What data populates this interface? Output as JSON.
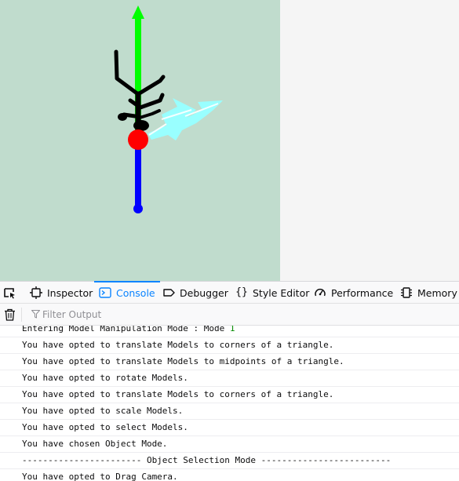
{
  "scene": {
    "background": "#c0dccd",
    "axis_colors": {
      "up": "#00ff00",
      "down": "#0000ff",
      "origin": "#ff0000",
      "model": "#000000",
      "arrow": "#99ffff"
    }
  },
  "devtools": {
    "tabs": [
      {
        "label": "Inspector",
        "icon": "inspector-icon"
      },
      {
        "label": "Console",
        "icon": "console-icon",
        "selected": true
      },
      {
        "label": "Debugger",
        "icon": "debugger-icon"
      },
      {
        "label": "Style Editor",
        "icon": "style-editor-icon"
      },
      {
        "label": "Performance",
        "icon": "performance-icon"
      },
      {
        "label": "Memory",
        "icon": "memory-icon"
      }
    ],
    "filter": {
      "placeholder": "Filter Output",
      "value": ""
    },
    "console_lines": [
      {
        "text": "Entering Model Manipulation Mode : Mode ",
        "num": "1"
      },
      {
        "text": "You have opted to translate Models to corners of a triangle."
      },
      {
        "text": "You have opted to translate Models to midpoints of a triangle."
      },
      {
        "text": "You have opted to rotate Models."
      },
      {
        "text": "You have opted to translate Models to corners of a triangle."
      },
      {
        "text": "You have opted to scale Models."
      },
      {
        "text": "You have opted to select Models."
      },
      {
        "text": "You have chosen Object Mode."
      },
      {
        "text": "----------------------- Object Selection Mode -------------------------"
      },
      {
        "text": "You have opted to Drag Camera."
      }
    ]
  }
}
